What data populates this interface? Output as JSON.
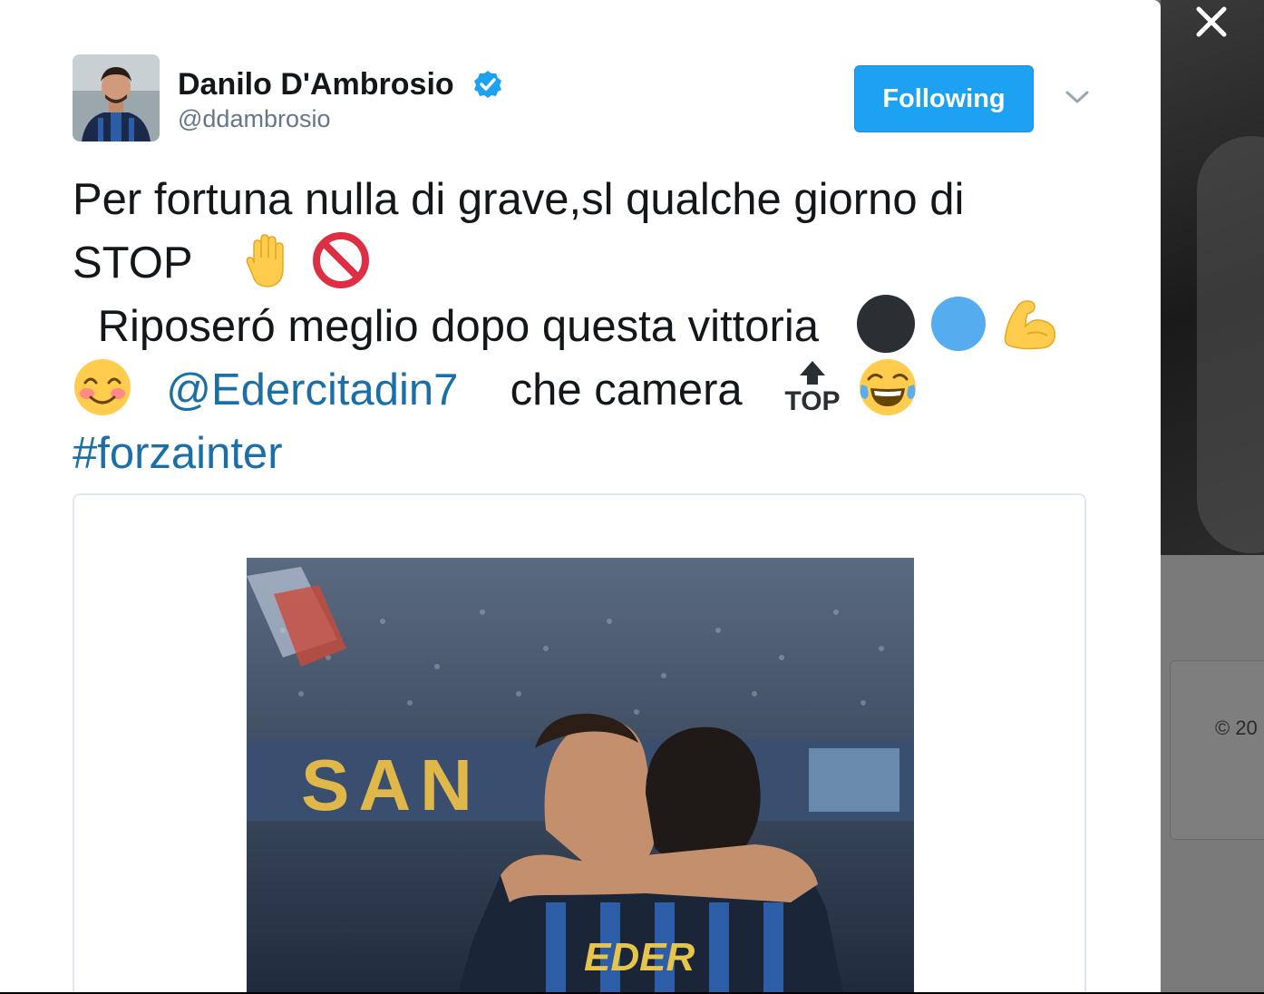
{
  "tweet": {
    "author": {
      "name": "Danilo D'Ambrosio",
      "handle": "@ddambrosio",
      "verified": true,
      "avatar_icon": "profile-photo"
    },
    "follow_button_label": "Following",
    "menu_icon": "chevron-down-icon",
    "text": {
      "line1": "Per fortuna nulla di grave,sl qualche giorno di",
      "line2_text": "STOP",
      "line3_text": "Riposeró meglio dopo questa vittoria",
      "mention": "@Edercitadin7",
      "line4_text": "che camera",
      "top_emoji_label": "TOP",
      "hashtag": "#forzainter"
    },
    "emojis": [
      "raised-hand-emoji",
      "no-entry-sign-emoji",
      "black-circle-emoji",
      "blue-circle-emoji",
      "flexed-biceps-emoji",
      "smiling-face-emoji",
      "top-arrow-emoji",
      "tears-of-joy-emoji"
    ],
    "photo": {
      "banner_text": "SAN",
      "jersey_text": "EDER"
    }
  },
  "background": {
    "copyright_text": "© 20"
  },
  "colors": {
    "accent": "#1da1f2",
    "link": "#1b6fa8",
    "text": "#14171a",
    "muted": "#657786"
  }
}
